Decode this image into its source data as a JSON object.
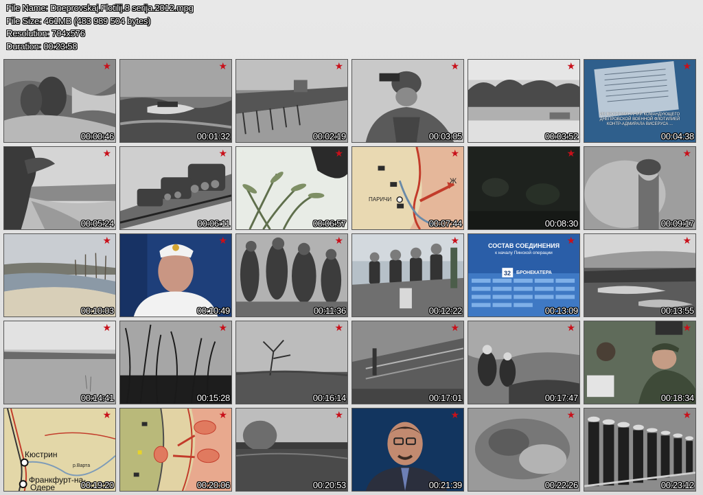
{
  "file_info": {
    "name_line": "File Name: Dneprovskaj.Flotilij.8 serija.2012.mpg",
    "size_line": "File Size: 461MB (483 989 504 bytes)",
    "resolution_line": "Resolution: 704x576",
    "duration_line": "Duration: 00:23:58"
  },
  "thumbnails": [
    {
      "time": "00:00:46"
    },
    {
      "time": "00:01:32"
    },
    {
      "time": "00:02:19"
    },
    {
      "time": "00:03:05"
    },
    {
      "time": "00:03:52"
    },
    {
      "time": "00:04:38"
    },
    {
      "time": "00:05:24"
    },
    {
      "time": "00:06:11"
    },
    {
      "time": "00:06:57"
    },
    {
      "time": "00:07:44"
    },
    {
      "time": "00:08:30"
    },
    {
      "time": "00:09:17"
    },
    {
      "time": "00:10:03"
    },
    {
      "time": "00:10:49"
    },
    {
      "time": "00:11:36"
    },
    {
      "time": "00:12:22"
    },
    {
      "time": "00:13:09"
    },
    {
      "time": "00:13:55"
    },
    {
      "time": "00:14:41"
    },
    {
      "time": "00:15:28"
    },
    {
      "time": "00:16:14"
    },
    {
      "time": "00:17:01"
    },
    {
      "time": "00:17:47"
    },
    {
      "time": "00:18:34"
    },
    {
      "time": "00:19:20"
    },
    {
      "time": "00:20:06"
    },
    {
      "time": "00:20:53"
    },
    {
      "time": "00:21:39"
    },
    {
      "time": "00:22:26"
    },
    {
      "time": "00:23:12"
    }
  ],
  "star_glyph": "★",
  "captions": {
    "t6_line1": "ИЗ ВОСПОМИНАНИЙ КОМАНДУЮЩЕГО",
    "t6_line2": "ДНЕПРОВСКОЙ ВОЕННОЙ ФЛОТИЛИЕЙ",
    "t6_line3": "КОНТР-АДМИРАЛА ВИСЕРУСА ...",
    "t10_parichi": "ПАРИЧИ",
    "t10_zh": "Ж",
    "t17_title": "СОСТАВ СОЕДИНЕНИЯ",
    "t17_sub": "к началу Пинской операции",
    "t17_num": "32",
    "t17_label": "БРОНЕКАТЕРА",
    "t25_kustrin": "Кюстрин",
    "t25_frankfurt": "Франкфурт-на-",
    "t25_odere": "Одере",
    "t25_varta": "р.Варта"
  },
  "colors": {
    "star": "#c8101a",
    "map_bg": "#e9d9b2",
    "info_blue": "#2a5ea8"
  }
}
